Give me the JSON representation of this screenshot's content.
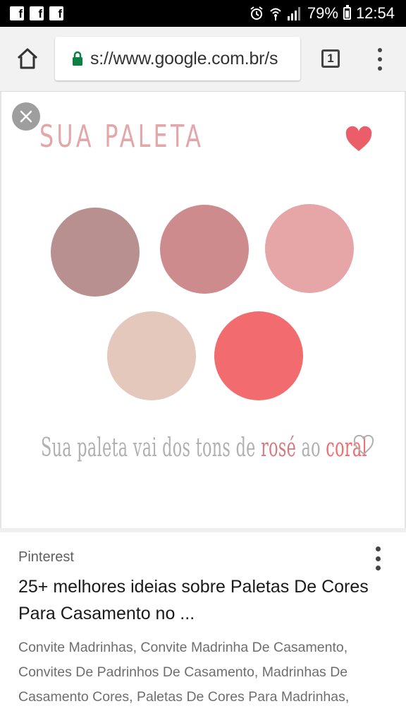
{
  "status_bar": {
    "app_icons": [
      "f",
      "f",
      "f"
    ],
    "battery": "79%",
    "time": "12:54"
  },
  "browser": {
    "url": "s://www.google.com.br/s",
    "tab_count": "1"
  },
  "image": {
    "title": "SUA PALETA",
    "caption_prefix": "Sua paleta vai dos tons de ",
    "caption_rose": "rosé",
    "caption_middle": " ao ",
    "caption_coral": "coral",
    "swatch_colors": [
      "#b99090",
      "#cd8b8d",
      "#e6a6a7",
      "#e5c8bc",
      "#f26c6f"
    ],
    "heart_color": "#ec5d6a"
  },
  "result": {
    "source": "Pinterest",
    "title": "25+ melhores ideias sobre Paletas De Cores Para Casamento no ...",
    "snippet": "Convite Madrinhas, Convite Madrinha De Casamento, Convites De Padrinhos De Casamento, Madrinhas De Casamento Cores, Paletas De Cores Para Madrinhas,"
  }
}
